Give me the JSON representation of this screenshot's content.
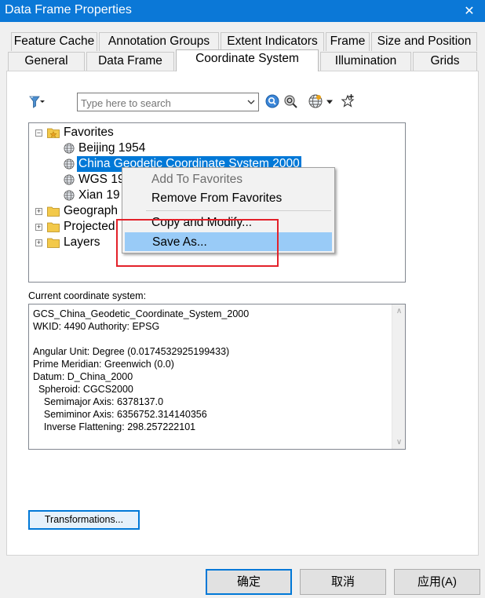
{
  "window": {
    "title": "Data Frame Properties",
    "close_glyph": "✕"
  },
  "tabs_row1": [
    {
      "label": "Feature Cache"
    },
    {
      "label": "Annotation Groups"
    },
    {
      "label": "Extent Indicators"
    },
    {
      "label": "Frame"
    },
    {
      "label": "Size and Position"
    }
  ],
  "tabs_row2": [
    {
      "label": "General"
    },
    {
      "label": "Data Frame"
    },
    {
      "label": "Coordinate System",
      "active": true
    },
    {
      "label": "Illumination"
    },
    {
      "label": "Grids"
    }
  ],
  "toolbar": {
    "filter_icon": "filter-icon",
    "search_placeholder": "Type here to search",
    "icons": [
      "search-icon",
      "search-options-icon",
      "globe-icon",
      "add-favorite-icon"
    ]
  },
  "tree": {
    "favorites": {
      "label": "Favorites",
      "expander": "−",
      "children": [
        {
          "label": "Beijing 1954"
        },
        {
          "label": "China Geodetic Coordinate System 2000",
          "selected": true
        },
        {
          "label": "WGS 19"
        },
        {
          "label": "Xian 19"
        }
      ]
    },
    "folders": [
      {
        "label": "Geograph",
        "expander": "+"
      },
      {
        "label": "Projected",
        "expander": "+"
      },
      {
        "label": "Layers",
        "expander": "+"
      }
    ]
  },
  "context_menu": {
    "items": [
      {
        "label": "Add To Favorites",
        "disabled": true
      },
      {
        "label": "Remove From Favorites"
      },
      {
        "label": "Copy and Modify..."
      },
      {
        "label": "Save As...",
        "hovered": true
      }
    ]
  },
  "current_system": {
    "label": "Current coordinate system:",
    "lines": [
      "GCS_China_Geodetic_Coordinate_System_2000",
      "WKID: 4490 Authority: EPSG",
      "",
      "Angular Unit: Degree (0.0174532925199433)",
      "Prime Meridian: Greenwich (0.0)",
      "Datum: D_China_2000",
      "  Spheroid: CGCS2000",
      "    Semimajor Axis: 6378137.0",
      "    Semiminor Axis: 6356752.314140356",
      "    Inverse Flattening: 298.257222101"
    ]
  },
  "transformations_label": "Transformations...",
  "buttons": {
    "ok": "确定",
    "cancel": "取消",
    "apply": "应用(A)"
  },
  "colors": {
    "title_bar": "#0b78d7",
    "selection": "#0078d7",
    "menu_hover": "#99cbf7",
    "highlight_box": "#e3212a"
  }
}
